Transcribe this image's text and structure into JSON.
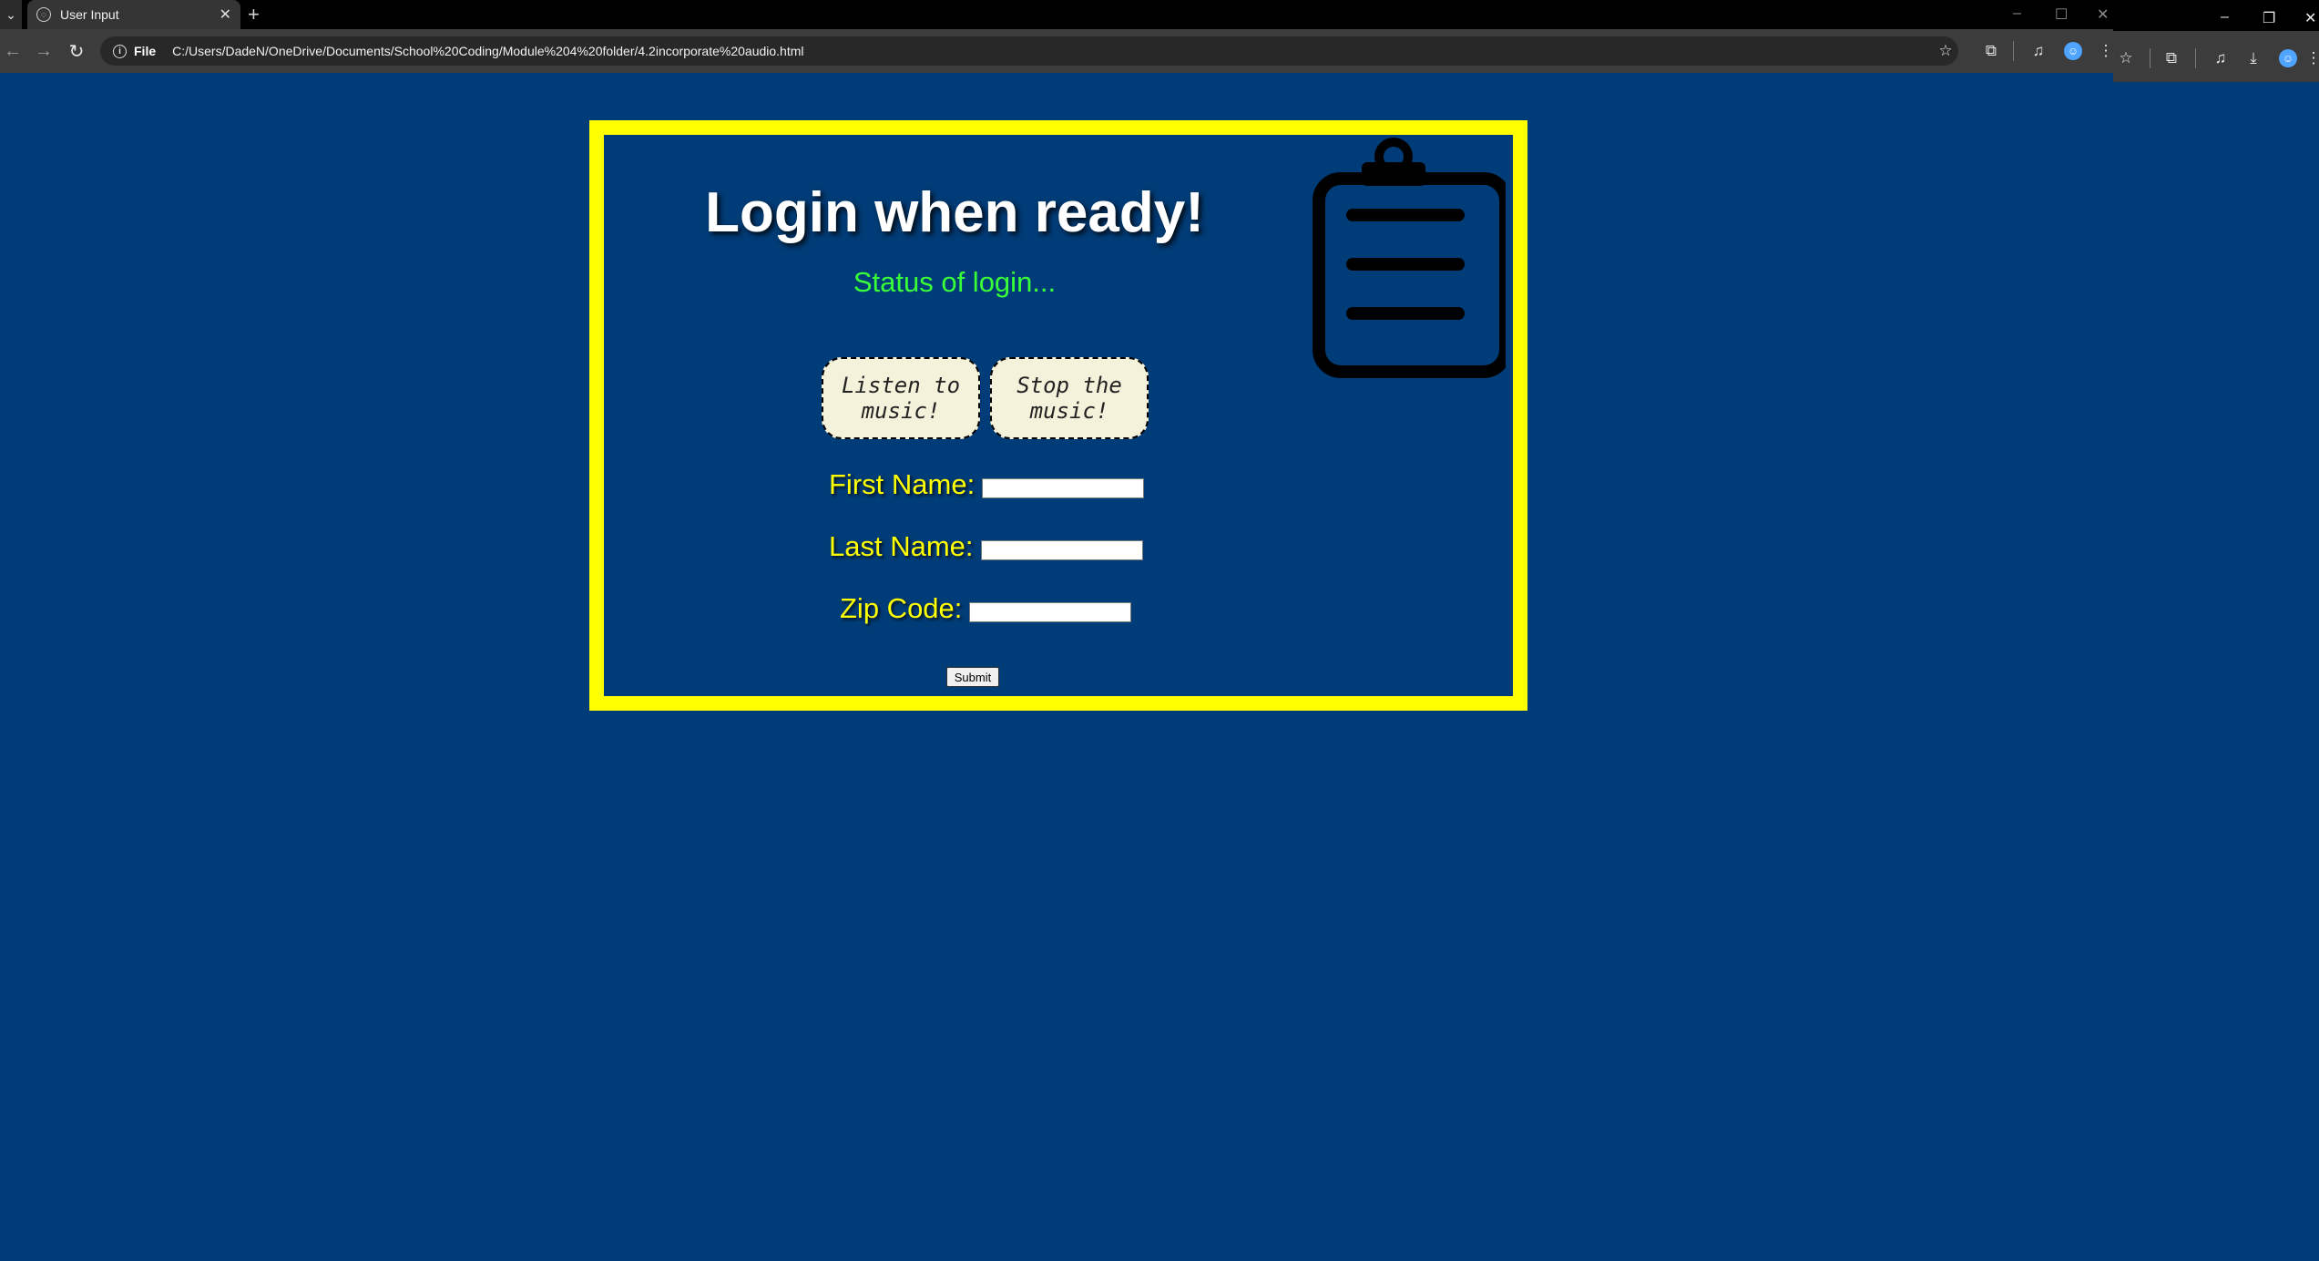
{
  "browser": {
    "tab_title": "User Input",
    "tab_close": "✕",
    "new_tab": "+",
    "url_scheme": "File",
    "url": "C:/Users/DadeN/OneDrive/Documents/School%20Coding/Module%204%20folder/4.2incorporate%20audio.html",
    "icons": [
      "back-icon",
      "forward-icon",
      "reload-icon",
      "info-icon",
      "star-icon",
      "extensions-icon",
      "media-icon",
      "profile-icon",
      "menu-icon",
      "download-icon"
    ]
  },
  "page": {
    "heading": "Login when ready!",
    "status": "Status of login...",
    "music": {
      "listen_label": "Listen to music!",
      "stop_label": "Stop the music!"
    },
    "form": {
      "first_name_label": "First Name:",
      "last_name_label": "Last Name:",
      "zip_label": "Zip Code:",
      "first_name_value": "",
      "last_name_value": "",
      "zip_value": "",
      "submit_label": "Submit"
    },
    "icon": "clipboard-icon"
  },
  "colors": {
    "background": "#003c77",
    "frame": "#ffff00",
    "heading": "#ffffff",
    "status": "#39ff39",
    "labels": "#ffff00",
    "music_button_bg": "#f5f2dc"
  }
}
